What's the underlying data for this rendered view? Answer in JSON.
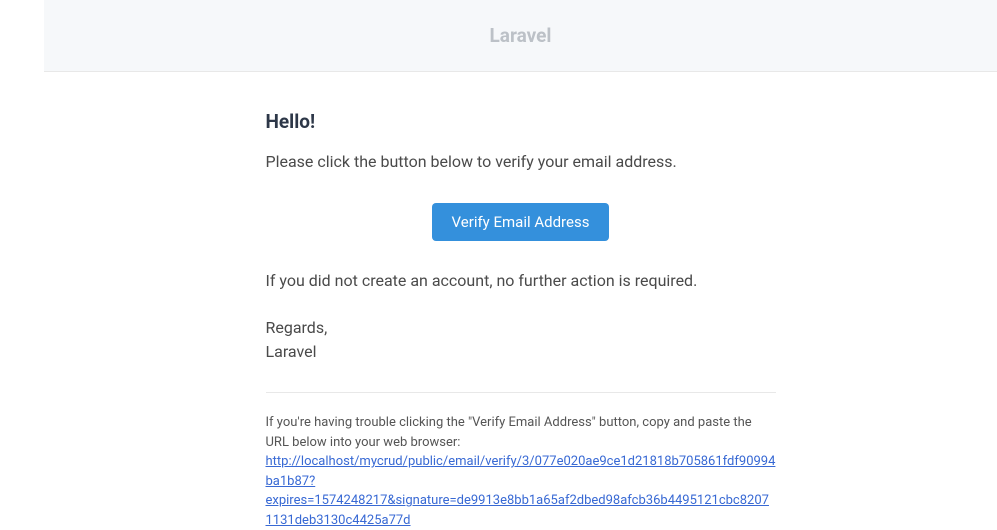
{
  "header": {
    "title": "Laravel"
  },
  "content": {
    "greeting": "Hello!",
    "instruction": "Please click the button below to verify your email address.",
    "button_label": "Verify Email Address",
    "no_action": "If you did not create an account, no further action is required.",
    "regards": "Regards,",
    "signature": "Laravel",
    "trouble_prefix": "If you're having trouble clicking the \"Verify Email Address\" button, copy and paste the URL below into your web browser: ",
    "url": "http://localhost/mycrud/public/email/verify/3/077e020ae9ce1d21818b705861fdf90994ba1b87?expires=1574248217&signature=de9913e8bb1a65af2dbed98afcb36b4495121cbc82071131deb3130c4425a77d"
  }
}
